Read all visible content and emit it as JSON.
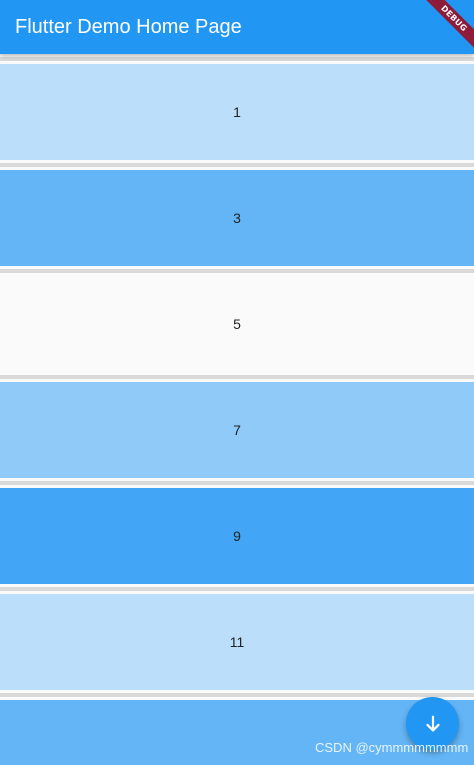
{
  "appbar": {
    "title": "Flutter Demo Home Page"
  },
  "debug_banner": {
    "label": "DEBUG"
  },
  "list": {
    "items": [
      {
        "label": "1"
      },
      {
        "label": "3"
      },
      {
        "label": "5"
      },
      {
        "label": "7"
      },
      {
        "label": "9"
      },
      {
        "label": "11"
      },
      {
        "label": ""
      }
    ]
  },
  "fab": {
    "icon": "arrow-downward-icon"
  },
  "watermark": {
    "text": "CSDN @cymmmmmmmm"
  },
  "colors": {
    "primary": "#2196f3",
    "blue_100": "#bbdefb",
    "blue_200": "#90caf9",
    "blue_300": "#64b5f6",
    "blue_400": "#42a5f5",
    "background": "#fafafa",
    "divider": "#d9d9d9",
    "debug_ribbon": "#8e1b3a"
  }
}
